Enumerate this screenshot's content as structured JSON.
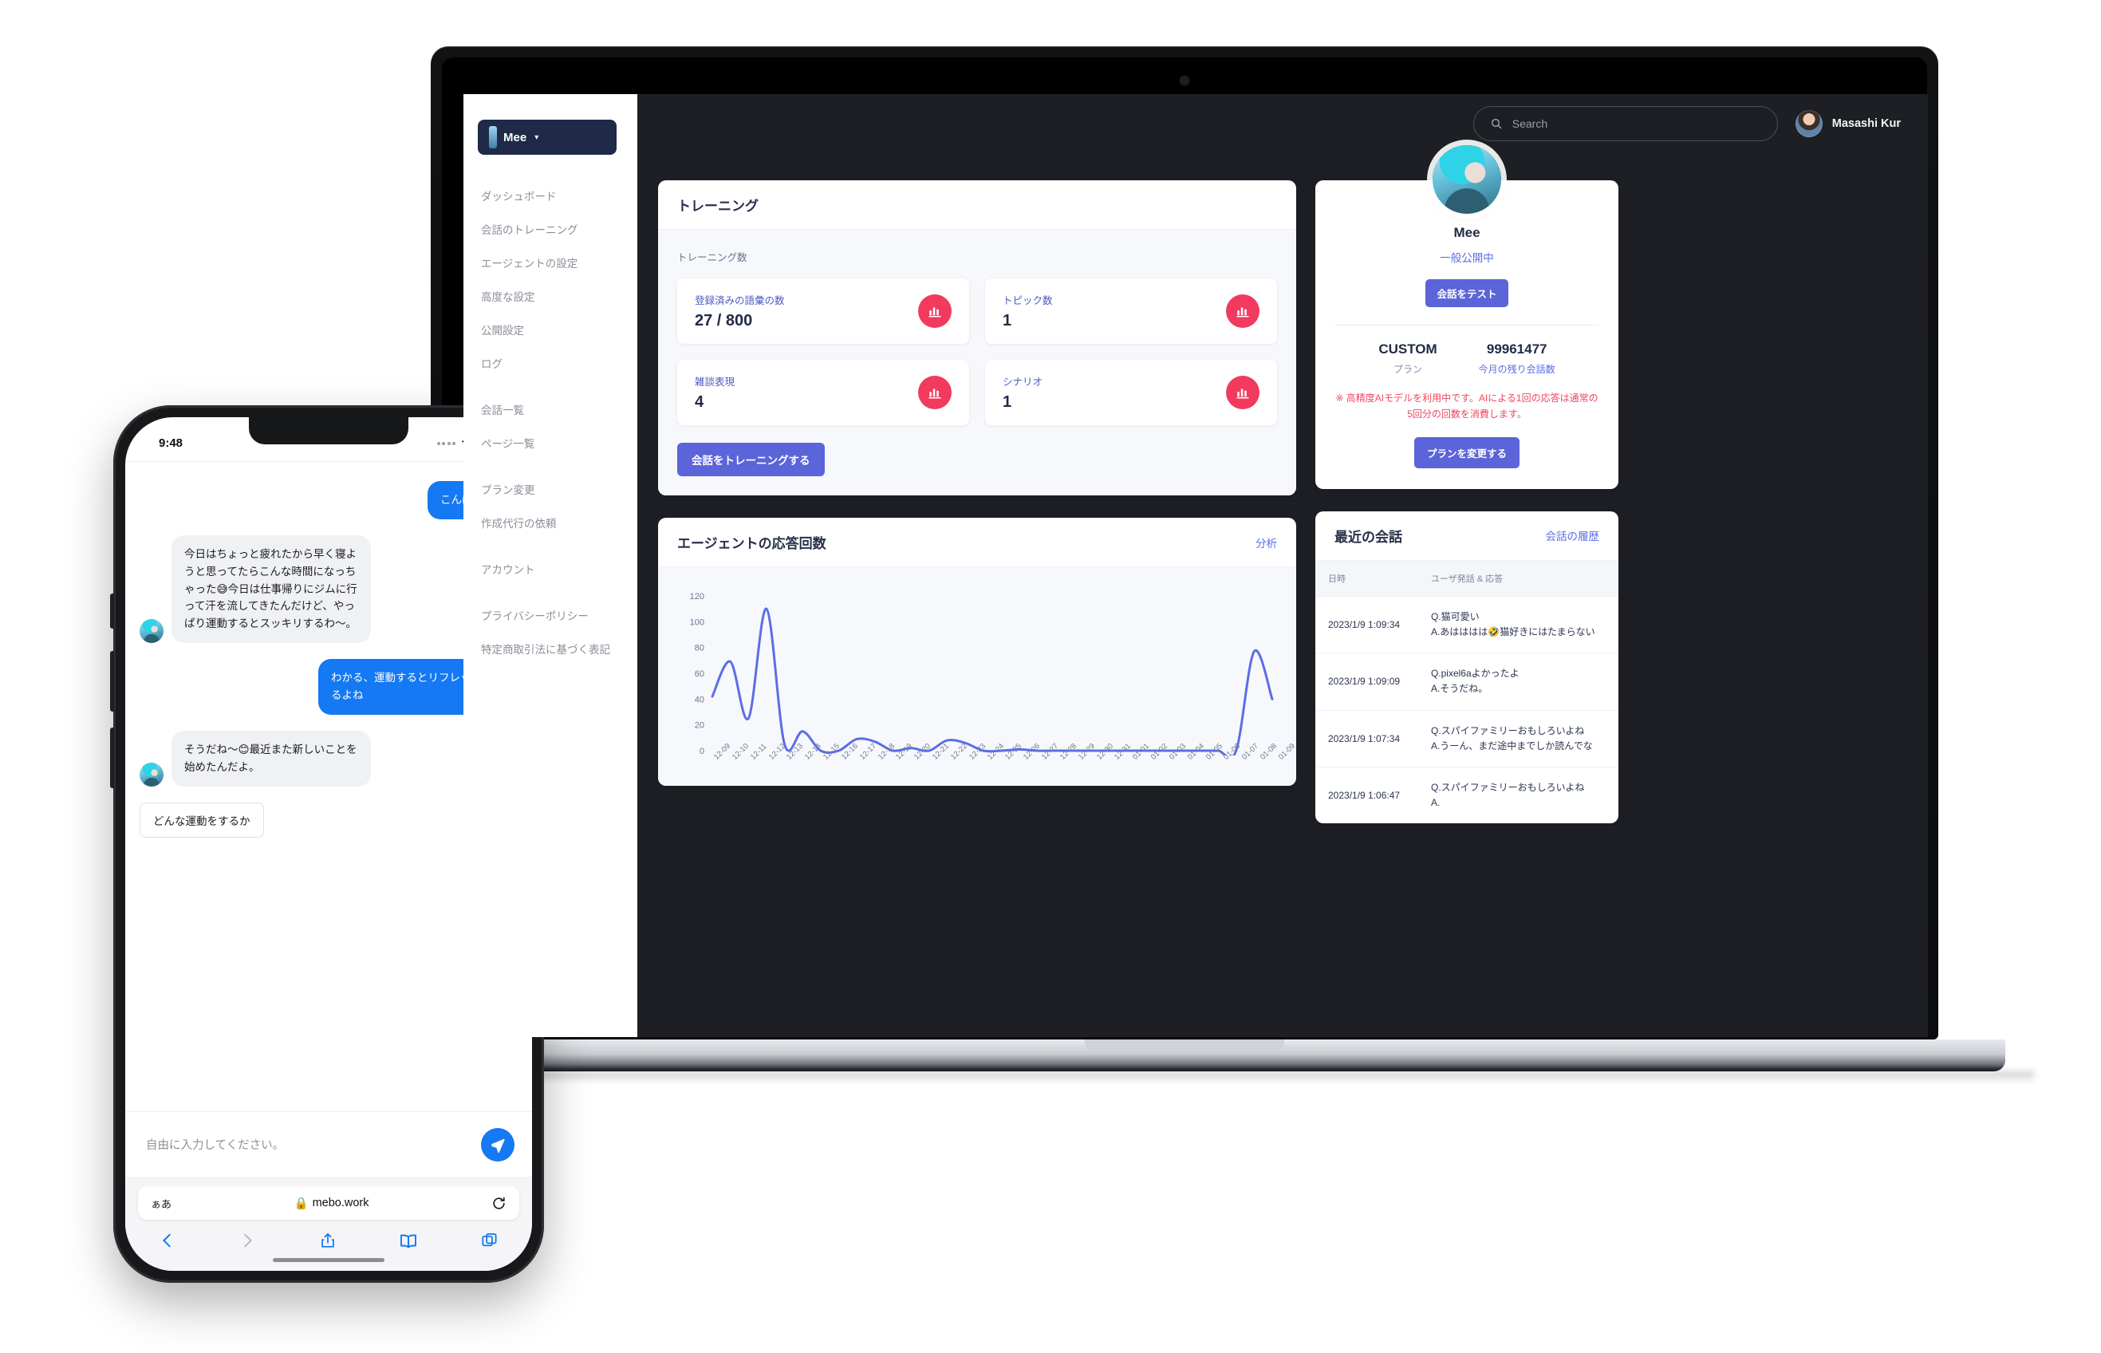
{
  "laptop": {
    "sidebar": {
      "brand": {
        "name": "Mee",
        "caret": "▾"
      },
      "items": [
        {
          "label": "ダッシュボード"
        },
        {
          "label": "会話のトレーニング"
        },
        {
          "label": "エージェントの設定"
        },
        {
          "label": "高度な設定"
        },
        {
          "label": "公開設定"
        },
        {
          "label": "ログ"
        },
        {
          "label": "会話一覧"
        },
        {
          "label": "ページ一覧"
        },
        {
          "label": "プラン変更"
        },
        {
          "label": "作成代行の依頼"
        },
        {
          "label": "アカウント"
        },
        {
          "label": "プライバシーポリシー"
        },
        {
          "label": "特定商取引法に基づく表記"
        }
      ]
    },
    "topbar": {
      "search_placeholder": "Search",
      "user_name": "Masashi Kur"
    },
    "training": {
      "title": "トレーニング",
      "sub_label": "トレーニング数",
      "stats": [
        {
          "key": "登録済みの語彙の数",
          "value": "27 / 800"
        },
        {
          "key": "トピック数",
          "value": "1"
        },
        {
          "key": "雑談表現",
          "value": "4"
        },
        {
          "key": "シナリオ",
          "value": "1"
        }
      ],
      "action_label": "会話をトレーニングする"
    },
    "chart_card": {
      "title": "エージェントの応答回数",
      "link": "分析"
    },
    "profile": {
      "name": "Mee",
      "status": "一般公開中",
      "test_button": "会話をテスト",
      "plan_value": "CUSTOM",
      "plan_key": "プラン",
      "credits_value": "99961477",
      "credits_key": "今月の残り会話数",
      "note": "※ 高精度AIモデルを利用中です。AIによる1回の応答は通常の5回分の回数を消費します。",
      "change_plan_button": "プランを変更する"
    },
    "recent": {
      "title": "最近の会話",
      "link": "会話の履歴",
      "columns": [
        "日時",
        "ユーザ発話 & 応答"
      ],
      "rows": [
        {
          "date": "2023/1/9 1:09:34",
          "q": "Q.猫可愛い",
          "a": "A.あはははは🤣猫好きにはたまらない"
        },
        {
          "date": "2023/1/9 1:09:09",
          "q": "Q.pixel6aよかったよ",
          "a": "A.そうだね。"
        },
        {
          "date": "2023/1/9 1:07:34",
          "q": "Q.スパイファミリーおもしろいよね",
          "a": "A.うーん、まだ途中までしか読んでな"
        },
        {
          "date": "2023/1/9 1:06:47",
          "q": "Q.スパイファミリーおもしろいよね",
          "a": "A."
        }
      ]
    }
  },
  "phone": {
    "status": {
      "time": "9:48"
    },
    "messages": [
      {
        "side": "me",
        "text": "こんばんは！"
      },
      {
        "side": "them",
        "text": "今日はちょっと疲れたから早く寝ようと思ってたらこんな時間になっちゃった😅今日は仕事帰りにジムに行って汗を流してきたんだけど、やっぱり運動するとスッキリするわ〜。"
      },
      {
        "side": "me",
        "text": "わかる、運動するとリフレッシュするよね"
      },
      {
        "side": "them",
        "text": "そうだね〜😊最近また新しいことを始めたんだよ。"
      }
    ],
    "suggestion": "どんな運動をするか",
    "composer_placeholder": "自由に入力してください。",
    "safari": {
      "aa": "ぁあ",
      "host": "mebo.work",
      "lock": "🔒"
    }
  },
  "colors": {
    "accent_blue": "#5b64d8",
    "stat_red": "#f13a5e",
    "chart_line": "#5b6ee6",
    "bubble_blue": "#1479f2",
    "note_red": "#f0465f"
  },
  "chart_data": {
    "type": "line",
    "title": "エージェントの応答回数",
    "xlabel": "",
    "ylabel": "",
    "ylim": [
      0,
      120
    ],
    "yticks": [
      0,
      20,
      40,
      60,
      80,
      100,
      120
    ],
    "grid": false,
    "legend": "none",
    "categories": [
      "12-09",
      "12-10",
      "12-11",
      "12-12",
      "12-13",
      "12-14",
      "12-15",
      "12-16",
      "12-17",
      "12-18",
      "12-19",
      "12-20",
      "12-21",
      "12-22",
      "12-23",
      "12-24",
      "12-25",
      "12-26",
      "12-27",
      "12-28",
      "12-29",
      "12-30",
      "12-31",
      "01-01",
      "01-02",
      "01-03",
      "01-04",
      "01-05",
      "01-06",
      "01-07",
      "01-08",
      "01-09"
    ],
    "values": [
      42,
      69,
      25,
      110,
      5,
      15,
      0,
      0,
      9,
      7,
      0,
      2,
      0,
      8,
      6,
      0,
      0,
      1,
      0,
      0,
      0,
      0,
      0,
      0,
      0,
      0,
      0,
      0,
      0,
      0,
      77,
      40
    ]
  }
}
